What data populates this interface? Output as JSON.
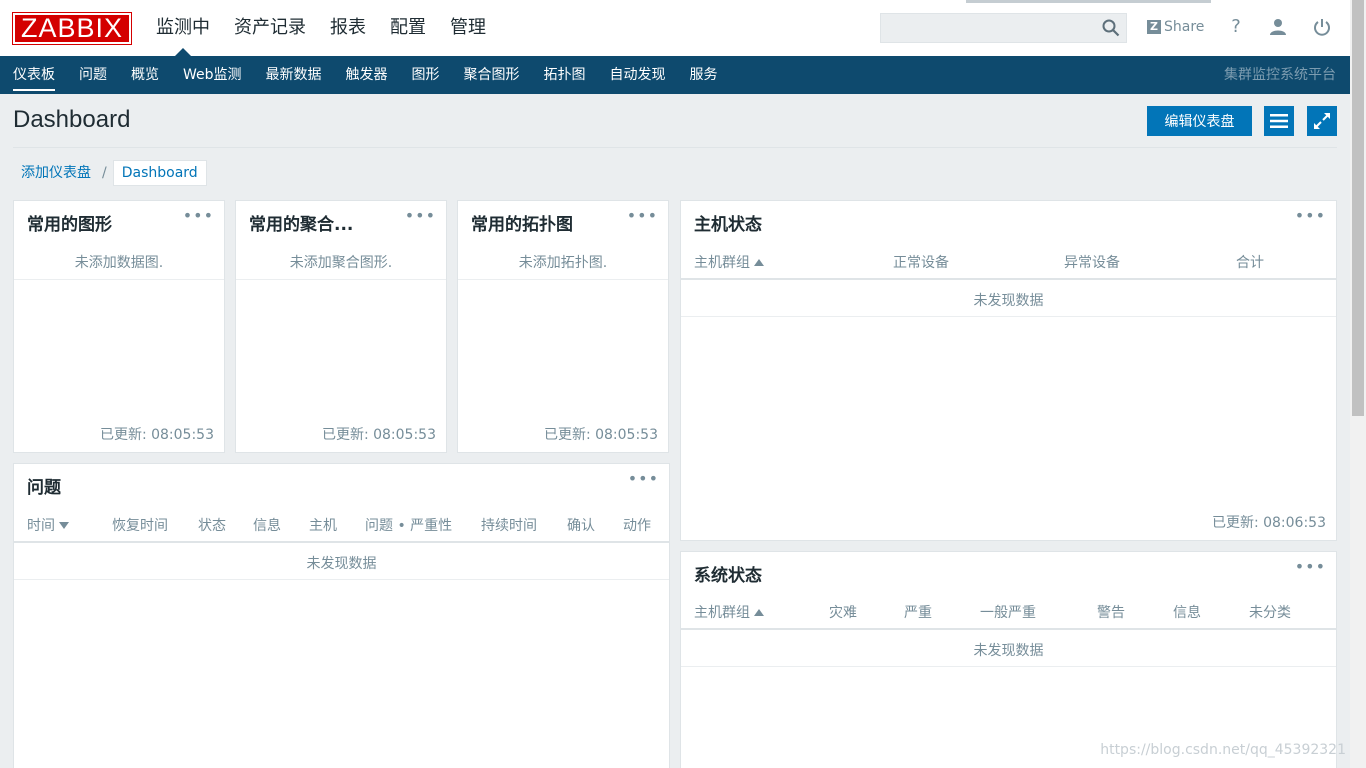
{
  "header": {
    "logo": "ZABBIX",
    "menu": [
      "监测中",
      "资产记录",
      "报表",
      "配置",
      "管理"
    ],
    "share_label": "Share",
    "help_glyph": "?",
    "colors": {
      "accent": "#0275b8",
      "nav_bg": "#0e4a6e",
      "logo_bg": "#d40000"
    }
  },
  "subnav": {
    "items": [
      "仪表板",
      "问题",
      "概览",
      "Web监测",
      "最新数据",
      "触发器",
      "图形",
      "聚合图形",
      "拓扑图",
      "自动发现",
      "服务"
    ],
    "right_title": "集群监控系统平台"
  },
  "page": {
    "title": "Dashboard",
    "edit_button": "编辑仪表盘",
    "breadcrumb": [
      "添加仪表盘",
      "Dashboard"
    ],
    "breadcrumb_sep": "/"
  },
  "widgets": {
    "fav_graphs": {
      "title": "常用的图形",
      "empty": "未添加数据图.",
      "updated": "已更新: 08:05:53"
    },
    "fav_screens": {
      "title": "常用的聚合...",
      "empty": "未添加聚合图形.",
      "updated": "已更新: 08:05:53"
    },
    "fav_maps": {
      "title": "常用的拓扑图",
      "empty": "未添加拓扑图.",
      "updated": "已更新: 08:05:53"
    },
    "host_status": {
      "title": "主机状态",
      "columns": [
        "主机群组",
        "正常设备",
        "异常设备",
        "合计"
      ],
      "empty": "未发现数据",
      "updated": "已更新: 08:06:53"
    },
    "problems": {
      "title": "问题",
      "columns": [
        "时间",
        "恢复时间",
        "状态",
        "信息",
        "主机",
        "问题 • 严重性",
        "持续时间",
        "确认",
        "动作"
      ],
      "empty": "未发现数据"
    },
    "system_status": {
      "title": "系统状态",
      "columns": [
        "主机群组",
        "灾难",
        "严重",
        "一般严重",
        "警告",
        "信息",
        "未分类"
      ],
      "empty": "未发现数据"
    },
    "menu_glyph": "•••"
  },
  "watermark": "https://blog.csdn.net/qq_45392321"
}
